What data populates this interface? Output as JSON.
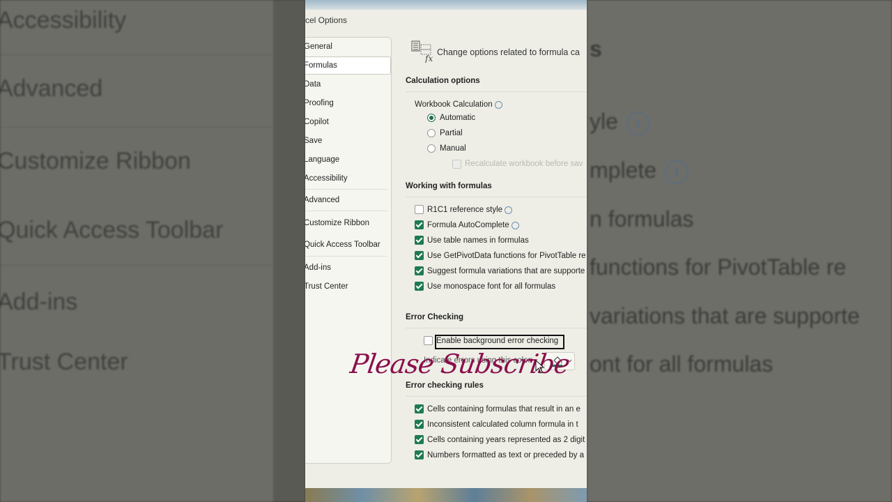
{
  "background": {
    "left_items": [
      "Accessibility",
      "Advanced",
      "Customize Ribbon",
      "Quick Access Toolbar",
      "Add-ins",
      "Trust Center"
    ],
    "right_items": [
      "yle",
      "mplete",
      "n formulas",
      "functions for PivotTable re",
      "variations that are supporte",
      "ont for all formulas"
    ],
    "right_title_fragment": "s"
  },
  "dialog": {
    "title": "cel Options",
    "sidebar": [
      "General",
      "Formulas",
      "Data",
      "Proofing",
      "Copilot",
      "Save",
      "Language",
      "Accessibility",
      "Advanced",
      "Customize Ribbon",
      "Quick Access Toolbar",
      "Add-ins",
      "Trust Center"
    ],
    "active_item": "Formulas",
    "header": "Change options related to formula ca",
    "calc": {
      "section": "Calculation options",
      "workbook_label": "Workbook Calculation",
      "options": [
        "Automatic",
        "Partial",
        "Manual"
      ],
      "selected": "Automatic",
      "recalc": "Recalculate workbook before sav"
    },
    "working": {
      "section": "Working with formulas",
      "items": [
        {
          "label": "R1C1 reference style",
          "checked": false,
          "info": true
        },
        {
          "label": "Formula AutoComplete",
          "checked": true,
          "info": true
        },
        {
          "label": "Use table names in formulas",
          "checked": true,
          "info": false
        },
        {
          "label": "Use GetPivotData functions for PivotTable re",
          "checked": true,
          "info": false
        },
        {
          "label": "Suggest formula variations that are supporte",
          "checked": true,
          "info": false
        },
        {
          "label": "Use monospace font for all formulas",
          "checked": true,
          "info": false
        }
      ]
    },
    "error_checking": {
      "section": "Error Checking",
      "enable": "Enable background error checking",
      "enable_checked": false,
      "indicate": "Indicate errors using this color:"
    },
    "rules": {
      "section": "Error checking rules",
      "items": [
        {
          "label": "Cells containing formulas that result in an e",
          "checked": true
        },
        {
          "label": "Inconsistent calculated column formula in t",
          "checked": true
        },
        {
          "label": "Cells containing years represented as 2 digit",
          "checked": true
        },
        {
          "label": "Numbers formatted as text or preceded by a",
          "checked": true
        }
      ]
    }
  },
  "overlay": {
    "text": "Please Subscribe",
    "color": "#8a0f4c"
  },
  "colors": {
    "accent": "#1f7a50",
    "error_indicator": "#1f7a50"
  },
  "icons": [
    "formula-icon",
    "info-icon",
    "paint-bucket-icon",
    "chevron-down-icon",
    "mouse-cursor-icon"
  ]
}
